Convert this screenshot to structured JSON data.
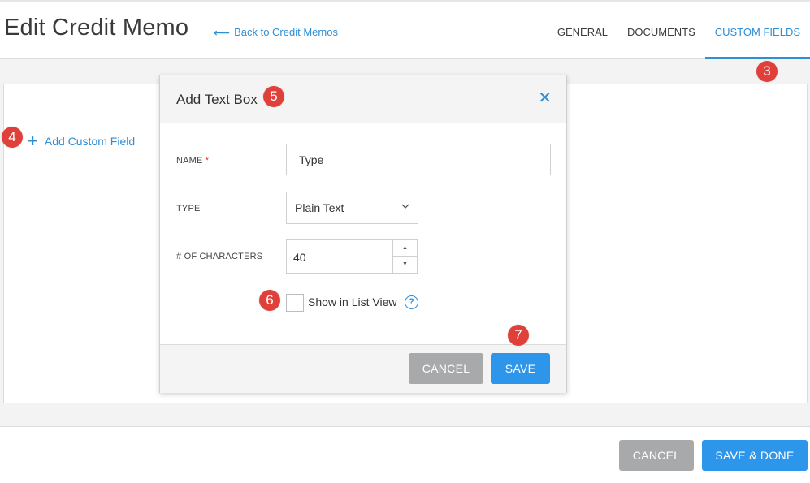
{
  "header": {
    "title": "Edit Credit Memo",
    "back_link": "Back to Credit Memos",
    "tabs": [
      {
        "label": "GENERAL"
      },
      {
        "label": "DOCUMENTS"
      },
      {
        "label": "CUSTOM FIELDS"
      }
    ]
  },
  "main": {
    "add_custom_field": "Add Custom Field"
  },
  "modal": {
    "title": "Add Text Box",
    "name_label": "NAME",
    "required_mark": "*",
    "name_value": "Type",
    "type_label": "TYPE",
    "type_value": "Plain Text",
    "chars_label": "# OF CHARACTERS",
    "chars_value": "40",
    "show_in_list_label": "Show in List View",
    "show_in_list_checked": false,
    "cancel_label": "CANCEL",
    "save_label": "SAVE"
  },
  "footer": {
    "cancel_label": "CANCEL",
    "save_done_label": "SAVE & DONE"
  },
  "annotations": [
    {
      "num": "3"
    },
    {
      "num": "4"
    },
    {
      "num": "5"
    },
    {
      "num": "6"
    },
    {
      "num": "7"
    }
  ],
  "colors": {
    "accent": "#2e8ed6",
    "button_blue": "#2d95ea",
    "button_gray": "#a7a9ab",
    "badge_red": "#e0403a"
  },
  "icons": {
    "back": "arrow-left-icon",
    "add": "plus-icon",
    "close": "close-icon",
    "select": "chevron-down-icon",
    "spinner_up": "caret-up-icon",
    "spinner_down": "caret-down-icon",
    "help": "question-circle-icon"
  }
}
